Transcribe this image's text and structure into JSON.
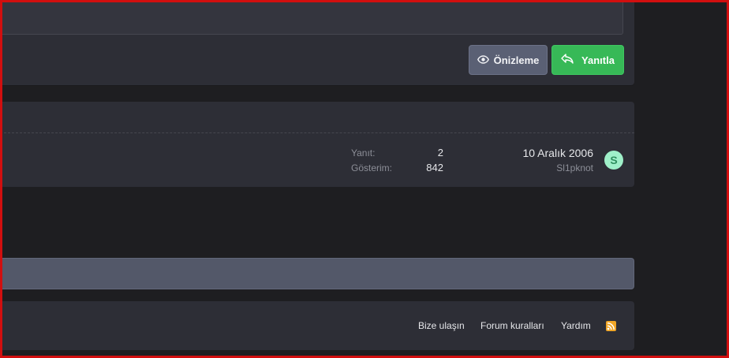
{
  "reply_box": {
    "preview_label": "Önizleme",
    "reply_label": "Yanıtla",
    "preview_icon": "eye-icon",
    "reply_icon": "reply-arrow-icon"
  },
  "thread": {
    "replies_label": "Yanıt:",
    "replies_value": "2",
    "views_label": "Gösterim:",
    "views_value": "842",
    "last_post_date": "10 Aralık 2006",
    "last_post_user": "Sl1pknot",
    "avatar_letter": "S"
  },
  "footer": {
    "links": [
      "Bize ulaşın",
      "Forum kuralları",
      "Yardım"
    ],
    "rss_icon": "rss-icon"
  },
  "colors": {
    "accent_green": "#37b957",
    "preview_button": "#5a6074",
    "avatar_bg": "#9ff0c9",
    "rss": "#f0a627",
    "frame": "#d10f0f"
  }
}
